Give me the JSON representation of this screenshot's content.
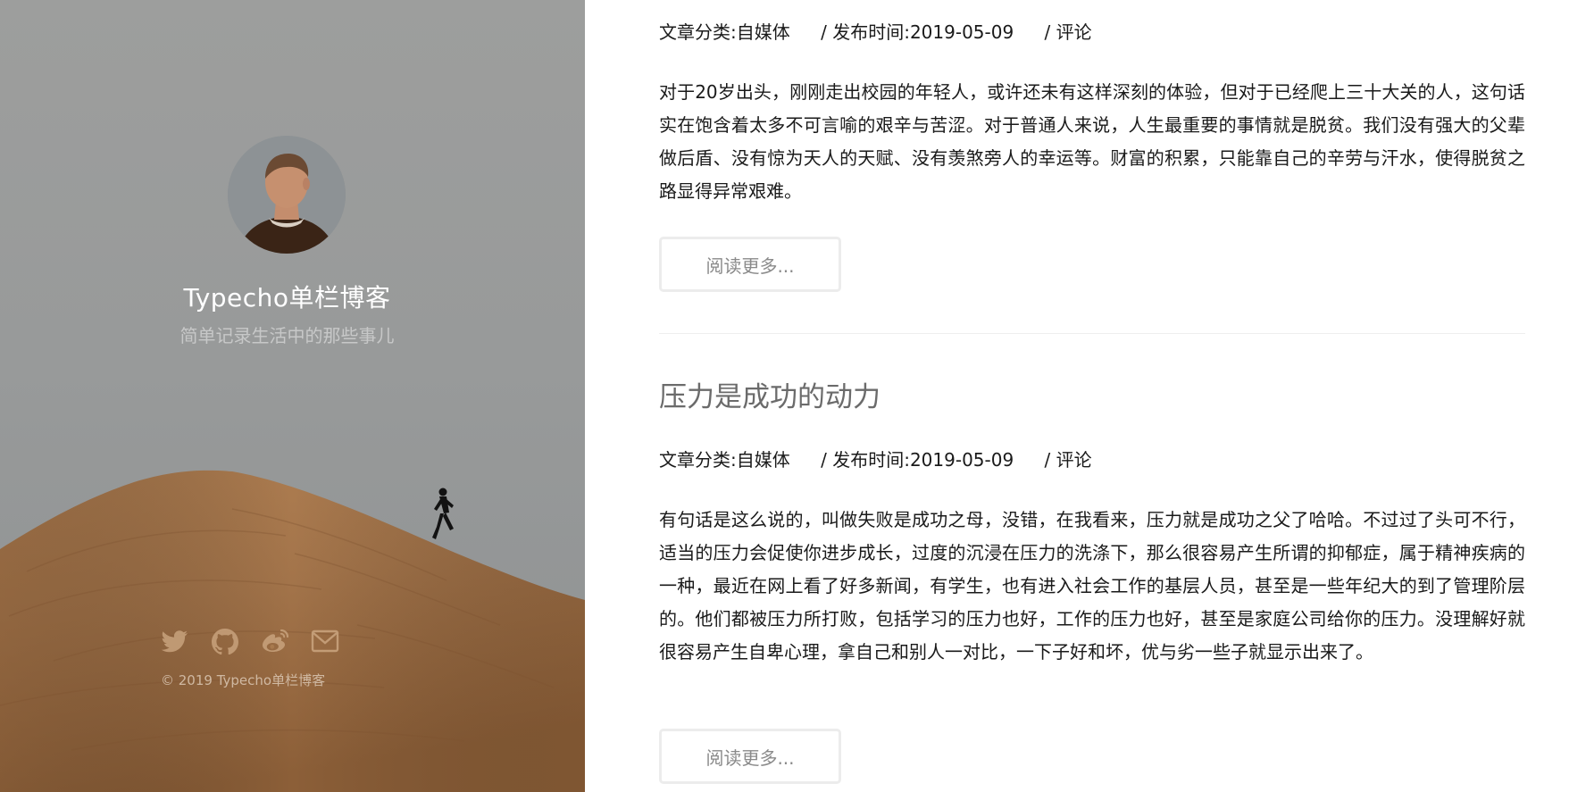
{
  "sidebar": {
    "site_title": "Typecho单栏博客",
    "subtitle": "简单记录生活中的那些事儿",
    "copyright": "© 2019 Typecho单栏博客",
    "social_icons": [
      "twitter-icon",
      "github-icon",
      "weibo-icon",
      "mail-icon"
    ]
  },
  "posts": [
    {
      "meta": {
        "category_label": "文章分类:",
        "category": "自媒体",
        "date_label": "/ 发布时间:",
        "date": "2019-05-09",
        "comment": "/ 评论"
      },
      "excerpt": "对于20岁出头，刚刚走出校园的年轻人，或许还未有这样深刻的体验，但对于已经爬上三十大关的人，这句话实在饱含着太多不可言喻的艰辛与苦涩。对于普通人来说，人生最重要的事情就是脱贫。我们没有强大的父辈做后盾、没有惊为天人的天赋、没有羡煞旁人的幸运等。财富的积累，只能靠自己的辛劳与汗水，使得脱贫之路显得异常艰难。",
      "read_more": "阅读更多..."
    },
    {
      "title": "压力是成功的动力",
      "meta": {
        "category_label": "文章分类:",
        "category": "自媒体",
        "date_label": "/ 发布时间:",
        "date": "2019-05-09",
        "comment": "/ 评论"
      },
      "excerpt": "有句话是这么说的，叫做失败是成功之母，没错，在我看来，压力就是成功之父了哈哈。不过过了头可不行，适当的压力会促使你进步成长，过度的沉浸在压力的洗涤下，那么很容易产生所谓的抑郁症，属于精神疾病的一种，最近在网上看了好多新闻，有学生，也有进入社会工作的基层人员，甚至是一些年纪大的到了管理阶层的。他们都被压力所打败，包括学习的压力也好，工作的压力也好，甚至是家庭公司给你的压力。没理解好就很容易产生自卑心理，拿自己和别人一对比，一下子好和坏，优与劣一些子就显示出来了。",
      "read_more": "阅读更多..."
    }
  ],
  "colors": {
    "sidebar_sky": "#9a9c9c",
    "dune": "#a87a4e",
    "title_gray": "#6b6b6b",
    "button_border": "#ececec"
  }
}
